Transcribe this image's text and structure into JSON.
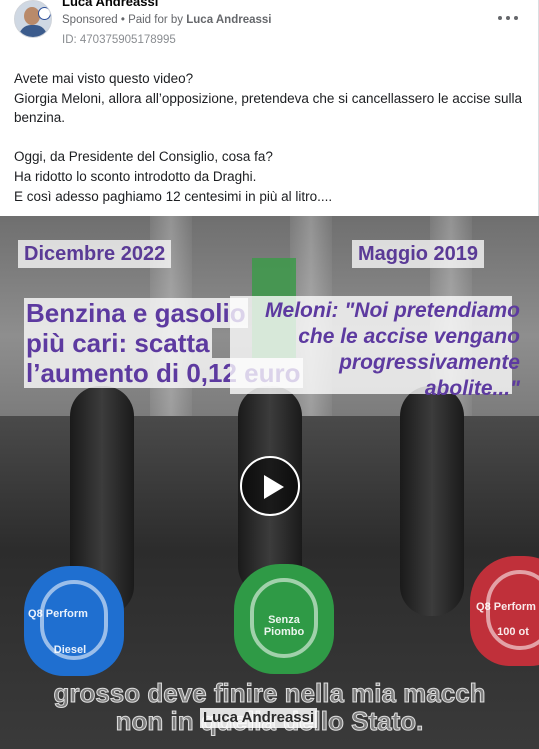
{
  "post": {
    "author": "Luca Andreassi",
    "sponsored_label": "Sponsored",
    "paid_for_prefix": "Paid for by",
    "payer": "Luca Andreassi",
    "ad_id": "ID: 470375905178995",
    "text_lines": [
      "Avete mai visto questo video?",
      "Giorgia Meloni, allora all’opposizione, pretendeva che si cancellassero le accise sulla benzina.",
      "",
      "Oggi, da Presidente del Consiglio, cosa fa?",
      "Ha ridotto lo sconto introdotto da Draghi.",
      "E così adesso paghiamo 12 centesimi in più al litro...."
    ]
  },
  "video": {
    "date_left": "Dicembre 2022",
    "date_right": "Maggio 2019",
    "headline_left": [
      "Benzina e gasolio",
      "più cari: scatta",
      "l’aumento di 0,12 euro"
    ],
    "quote_right": [
      "Meloni: \"Noi pretendiamo",
      "che le accise vengano",
      "progressivamente",
      "abolite...\""
    ],
    "nozzles": [
      {
        "brand": "Q8 Perform",
        "label": "Diesel",
        "color": "#1f6fd0"
      },
      {
        "brand": "",
        "label": "Senza Piombo",
        "color": "#2f9a46"
      },
      {
        "brand": "Q8 Perform",
        "label": "100 ot",
        "color": "#c0303a"
      }
    ],
    "subtitle_line1": "grosso deve finire nella mia macch",
    "subtitle_line2": "non in quella dello Stato.",
    "watermark": "Luca Andreassi",
    "play_icon": "play-icon"
  }
}
